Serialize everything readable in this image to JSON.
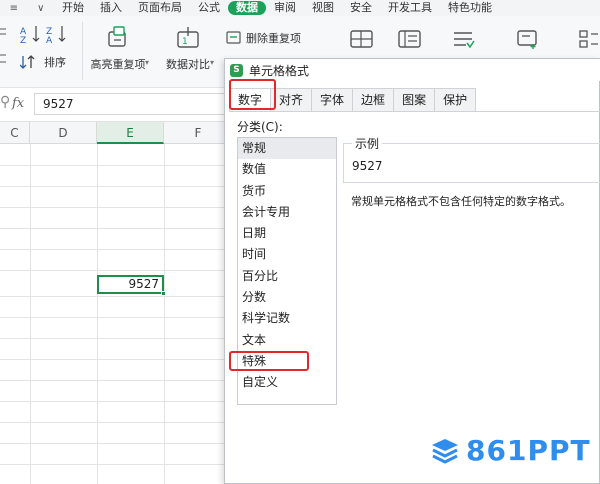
{
  "ribbon_tabs": [
    "开始",
    "插入",
    "页面布局",
    "公式",
    "数据",
    "审阅",
    "视图",
    "安全",
    "开发工具",
    "特色功能"
  ],
  "active_ribbon_tab": "数据",
  "ribbon": {
    "sort_label": "排序",
    "highlight_dup_label": "高亮重复项",
    "compare_label": "数据对比",
    "delete_dup_label": "删除重复项"
  },
  "formula_bar": {
    "fx_label": "fx",
    "value": "9527"
  },
  "sheet": {
    "columns": [
      "C",
      "D",
      "E",
      "F"
    ],
    "selected_column": "E",
    "active_cell_value": "9527"
  },
  "dialog": {
    "icon_letter": "S",
    "title": "单元格格式",
    "tabs": [
      "数字",
      "对齐",
      "字体",
      "边框",
      "图案",
      "保护"
    ],
    "active_tab": "数字",
    "category_label": "分类(C):",
    "categories": [
      "常规",
      "数值",
      "货币",
      "会计专用",
      "日期",
      "时间",
      "百分比",
      "分数",
      "科学记数",
      "文本",
      "特殊",
      "自定义"
    ],
    "selected_category": "常规",
    "sample_label": "示例",
    "sample_value": "9527",
    "description": "常规单元格格式不包含任何特定的数字格式。"
  },
  "annotations": {
    "highlight_color": "#e02a2a",
    "highlighted": [
      "数字",
      "特殊"
    ]
  },
  "watermark": {
    "text": "861PPT",
    "color": "#2f8df0"
  },
  "colors": {
    "accent_green": "#1aa25a",
    "cell_border": "#1e8e4d"
  }
}
